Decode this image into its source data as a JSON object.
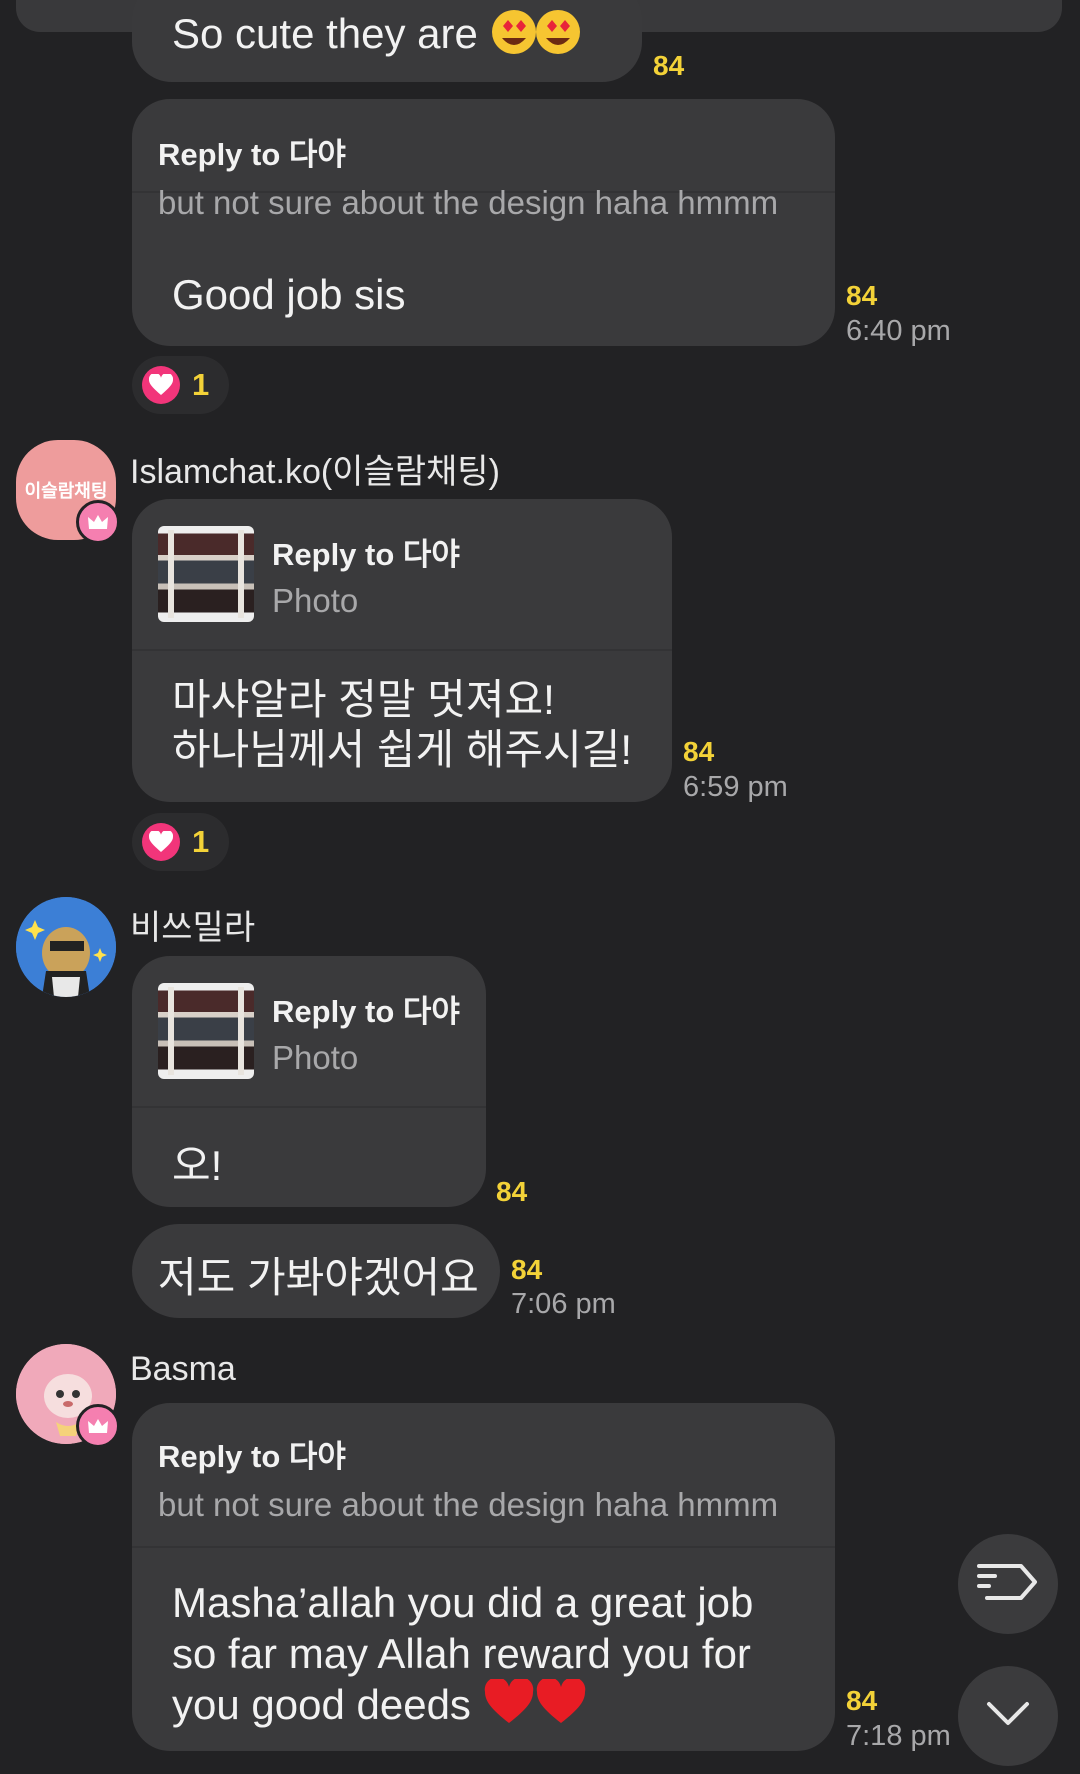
{
  "messages": [
    {
      "text": "So cute they are",
      "count": "84"
    },
    {
      "reply_label": "Reply to 다야",
      "reply_snippet": "but not sure about the design haha hmmm",
      "text": "Good job sis",
      "count": "84",
      "time": "6:40 pm",
      "reaction": "1"
    },
    {
      "sender": "Islamchat.ko(이슬람채팅)",
      "avatar_text": "이슬람채팅",
      "reply_label": "Reply to 다야",
      "reply_snippet": "Photo",
      "text_line1": "마샤알라 정말 멋져요!",
      "text_line2": "하나님께서 쉽게 해주시길!",
      "count": "84",
      "time": "6:59 pm",
      "reaction": "1"
    },
    {
      "sender": "비쓰밀라",
      "reply_label": "Reply to 다야",
      "reply_snippet": "Photo",
      "text": "오!",
      "count": "84"
    },
    {
      "text": "저도 가봐야겠어요",
      "count": "84",
      "time": "7:06 pm"
    },
    {
      "sender": "Basma",
      "reply_label": "Reply to 다야",
      "reply_snippet": "but not sure about the design haha hmmm",
      "text_line1": "Masha’allah you did a great job",
      "text_line2": "so far may Allah reward you for",
      "text_line3": "you good deeds",
      "count": "84",
      "time": "7:18 pm"
    }
  ],
  "icons": [
    "heart-emoji-eyes-icon",
    "crown-icon",
    "heart-icon",
    "message-list-icon",
    "chevron-down-icon"
  ],
  "colors": {
    "background": "#222224",
    "bubble": "#3a3a3c",
    "unread_count": "#f3d238",
    "heart": "#f2357a"
  }
}
